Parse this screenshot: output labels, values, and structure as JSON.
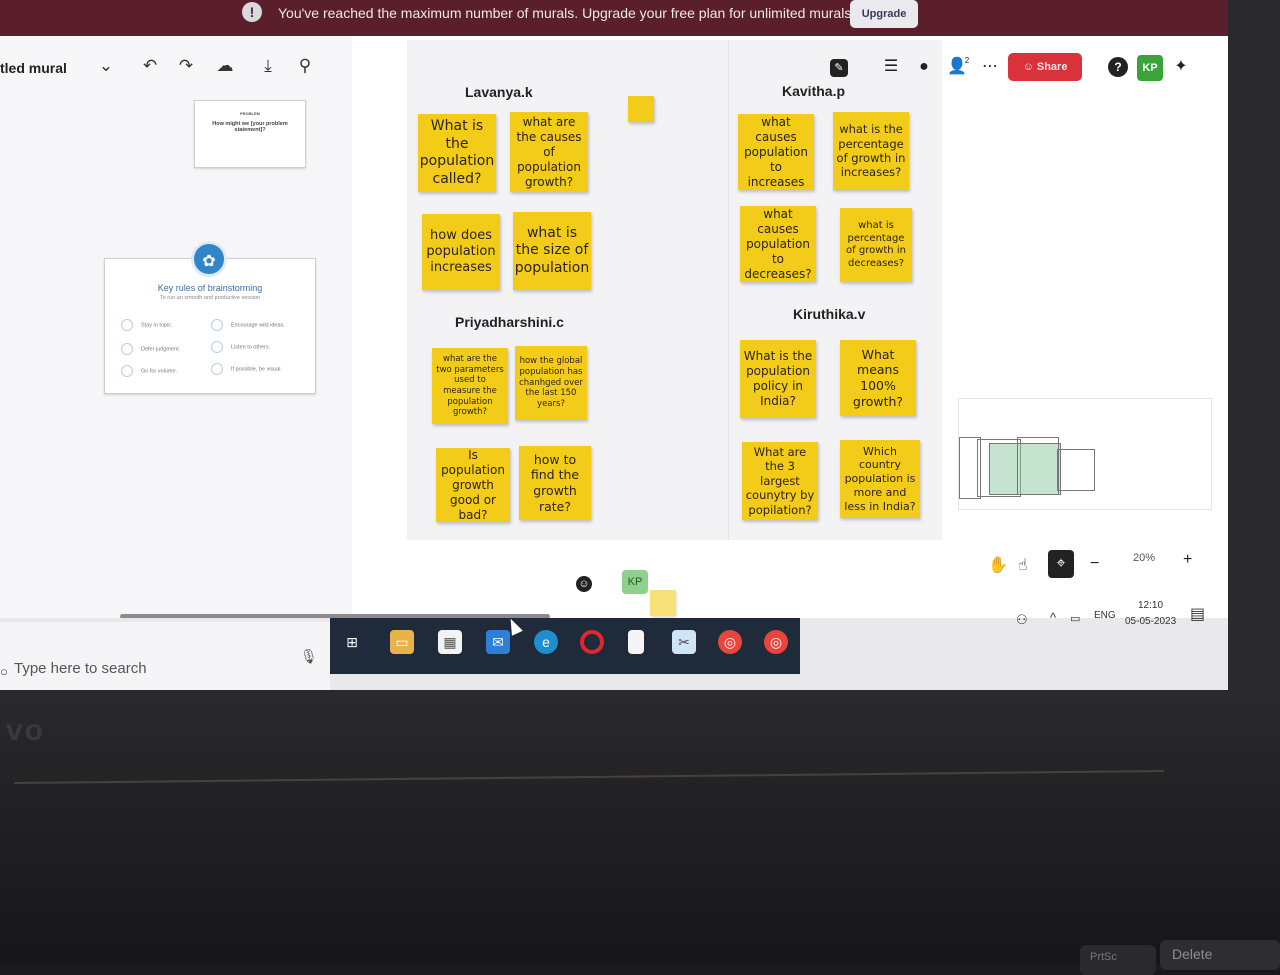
{
  "banner": {
    "message": "You've reached the maximum number of murals. Upgrade your free plan for unlimited murals.",
    "upgrade_label": "Upgrade",
    "icon": "alert-icon"
  },
  "toolbar": {
    "title": "tled mural",
    "icons": [
      "chevron-down-icon",
      "undo-icon",
      "redo-icon",
      "cloud-icon",
      "download-icon",
      "search-icon"
    ]
  },
  "cards": {
    "problem": {
      "label": "PROBLEM",
      "text": "How might we [your problem statement]?"
    },
    "rules": {
      "title": "Key rules of brainstorming",
      "subtitle": "To run an smooth and productive session",
      "items": [
        "Stay in topic.",
        "Encourage wild ideas.",
        "Defer judgment.",
        "Listen to others.",
        "Go for volume.",
        "If possible, be visual."
      ]
    }
  },
  "groups": {
    "lavanya": {
      "name": "Lavanya.k",
      "notes": [
        "What is the population called?",
        "what are the causes of population growth?",
        "how does population increases",
        "what is the size of population"
      ]
    },
    "kavitha": {
      "name": "Kavitha.p",
      "notes": [
        "what causes population to increases",
        "what is the percentage of growth in increases?",
        "what causes population to decreases?",
        "what is percentage of growth in decreases?"
      ]
    },
    "priyadharshini": {
      "name": "Priyadharshini.c",
      "notes": [
        "what are the two parameters used to measure the population growth?",
        "how the global population has chanhged over the last 150 years?",
        "Is population growth good or bad?",
        "how to find the growth rate?"
      ]
    },
    "kiruthika": {
      "name": "Kiruthika.v",
      "notes": [
        "What is the population policy in India?",
        "What means 100% growth?",
        "What are the 3 largest counytry by popilation?",
        "Which country population is more and less in India?"
      ]
    }
  },
  "right_toolbar": {
    "share_label": "Share",
    "avatar_initials": "KP",
    "notification_count": "2",
    "icons": [
      "note-icon",
      "outline-icon",
      "chat-icon",
      "user-icon",
      "more-icon",
      "help-icon",
      "sparkle-icon"
    ]
  },
  "bottom": {
    "zoom": "20%",
    "cursor_initials": "KP"
  },
  "taskbar": {
    "search_placeholder": "Type here to search",
    "lang": "ENG",
    "time": "12:10",
    "date": "05-05-2023",
    "apps": [
      "task-view-icon",
      "folder-icon",
      "store-icon",
      "mail-icon",
      "edge-icon",
      "opera-icon",
      "file-icon",
      "snip-icon",
      "chrome-icon",
      "chrome-icon"
    ]
  },
  "keyboard": {
    "delete_label": "Delete",
    "prtsc_label": "PrtSc",
    "brand": "vo"
  },
  "colors": {
    "banner": "#5b1f2b",
    "sticky": "#f3cc1a",
    "share": "#d9323b",
    "avatar": "#3aa43a"
  }
}
